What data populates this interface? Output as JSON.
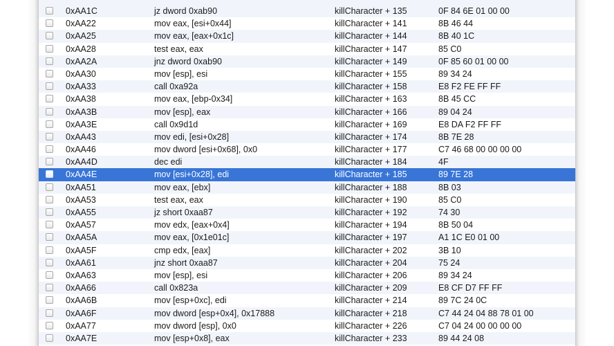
{
  "rows": [
    {
      "addr": "0xAA1C",
      "instr": "jz dword 0xab90",
      "sym": "killCharacter + 135",
      "bytes": "0F 84 6E 01 00 00",
      "selected": false
    },
    {
      "addr": "0xAA22",
      "instr": "mov eax, [esi+0x44]",
      "sym": "killCharacter + 141",
      "bytes": "8B 46 44",
      "selected": false
    },
    {
      "addr": "0xAA25",
      "instr": "mov eax, [eax+0x1c]",
      "sym": "killCharacter + 144",
      "bytes": "8B 40 1C",
      "selected": false
    },
    {
      "addr": "0xAA28",
      "instr": "test eax, eax",
      "sym": "killCharacter + 147",
      "bytes": "85 C0",
      "selected": false
    },
    {
      "addr": "0xAA2A",
      "instr": "jnz dword 0xab90",
      "sym": "killCharacter + 149",
      "bytes": "0F 85 60 01 00 00",
      "selected": false
    },
    {
      "addr": "0xAA30",
      "instr": "mov [esp], esi",
      "sym": "killCharacter + 155",
      "bytes": "89 34 24",
      "selected": false
    },
    {
      "addr": "0xAA33",
      "instr": "call 0xa92a",
      "sym": "killCharacter + 158",
      "bytes": "E8 F2 FE FF FF",
      "selected": false
    },
    {
      "addr": "0xAA38",
      "instr": "mov eax, [ebp-0x34]",
      "sym": "killCharacter + 163",
      "bytes": "8B 45 CC",
      "selected": false
    },
    {
      "addr": "0xAA3B",
      "instr": "mov [esp], eax",
      "sym": "killCharacter + 166",
      "bytes": "89 04 24",
      "selected": false
    },
    {
      "addr": "0xAA3E",
      "instr": "call 0x9d1d",
      "sym": "killCharacter + 169",
      "bytes": "E8 DA F2 FF FF",
      "selected": false
    },
    {
      "addr": "0xAA43",
      "instr": "mov edi, [esi+0x28]",
      "sym": "killCharacter + 174",
      "bytes": "8B 7E 28",
      "selected": false
    },
    {
      "addr": "0xAA46",
      "instr": "mov dword [esi+0x68], 0x0",
      "sym": "killCharacter + 177",
      "bytes": "C7 46 68 00 00 00 00",
      "selected": false
    },
    {
      "addr": "0xAA4D",
      "instr": "dec edi",
      "sym": "killCharacter + 184",
      "bytes": "4F",
      "selected": false
    },
    {
      "addr": "0xAA4E",
      "instr": "mov [esi+0x28], edi",
      "sym": "killCharacter + 185",
      "bytes": "89 7E 28",
      "selected": true
    },
    {
      "addr": "0xAA51",
      "instr": "mov eax, [ebx]",
      "sym": "killCharacter + 188",
      "bytes": "8B 03",
      "selected": false
    },
    {
      "addr": "0xAA53",
      "instr": "test eax, eax",
      "sym": "killCharacter + 190",
      "bytes": "85 C0",
      "selected": false
    },
    {
      "addr": "0xAA55",
      "instr": "jz short 0xaa87",
      "sym": "killCharacter + 192",
      "bytes": "74 30",
      "selected": false
    },
    {
      "addr": "0xAA57",
      "instr": "mov edx, [eax+0x4]",
      "sym": "killCharacter + 194",
      "bytes": "8B 50 04",
      "selected": false
    },
    {
      "addr": "0xAA5A",
      "instr": "mov eax, [0x1e01c]",
      "sym": "killCharacter + 197",
      "bytes": "A1 1C E0 01 00",
      "selected": false
    },
    {
      "addr": "0xAA5F",
      "instr": "cmp edx, [eax]",
      "sym": "killCharacter + 202",
      "bytes": "3B 10",
      "selected": false
    },
    {
      "addr": "0xAA61",
      "instr": "jnz short 0xaa87",
      "sym": "killCharacter + 204",
      "bytes": "75 24",
      "selected": false
    },
    {
      "addr": "0xAA63",
      "instr": "mov [esp], esi",
      "sym": "killCharacter + 206",
      "bytes": "89 34 24",
      "selected": false
    },
    {
      "addr": "0xAA66",
      "instr": "call 0x823a",
      "sym": "killCharacter + 209",
      "bytes": "E8 CF D7 FF FF",
      "selected": false
    },
    {
      "addr": "0xAA6B",
      "instr": "mov [esp+0xc], edi",
      "sym": "killCharacter + 214",
      "bytes": "89 7C 24 0C",
      "selected": false
    },
    {
      "addr": "0xAA6F",
      "instr": "mov dword [esp+0x4], 0x17888",
      "sym": "killCharacter + 218",
      "bytes": "C7 44 24 04 88 78 01 00",
      "selected": false
    },
    {
      "addr": "0xAA77",
      "instr": "mov dword [esp], 0x0",
      "sym": "killCharacter + 226",
      "bytes": "C7 04 24 00 00 00 00",
      "selected": false
    },
    {
      "addr": "0xAA7E",
      "instr": "mov [esp+0x8], eax",
      "sym": "killCharacter + 233",
      "bytes": "89 44 24 08",
      "selected": false
    }
  ],
  "colors": {
    "selection": "#3875d7",
    "stripe": "#f1f5fb"
  }
}
